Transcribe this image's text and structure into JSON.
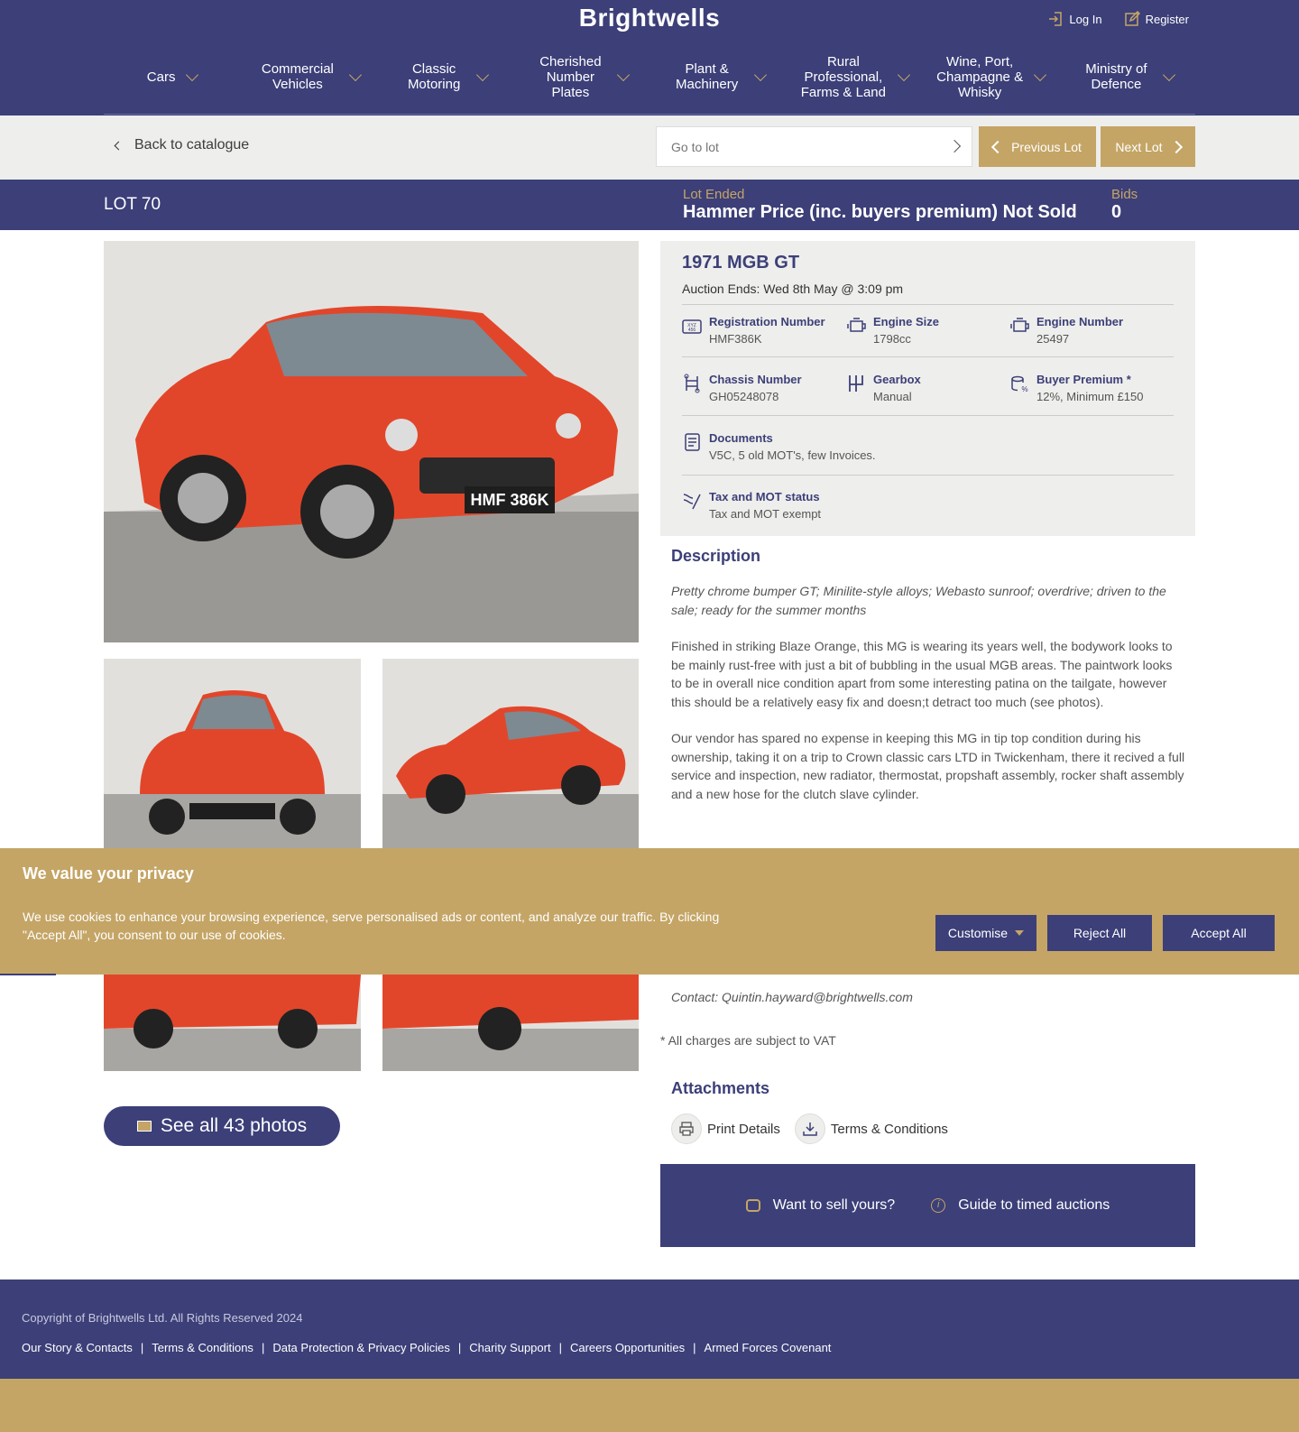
{
  "brand": {
    "name": "Brightwells"
  },
  "auth": {
    "login": "Log In",
    "register": "Register"
  },
  "nav": [
    {
      "label": "Cars"
    },
    {
      "label": "Commercial Vehicles"
    },
    {
      "label": "Classic Motoring"
    },
    {
      "label": "Cherished Number Plates"
    },
    {
      "label": "Plant & Machinery"
    },
    {
      "label": "Rural Professional, Farms & Land"
    },
    {
      "label": "Wine, Port, Champagne & Whisky"
    },
    {
      "label": "Ministry of Defence"
    }
  ],
  "toolbar": {
    "back": "Back to catalogue",
    "goto_placeholder": "Go to lot",
    "prev": "Previous Lot",
    "next": "Next Lot"
  },
  "lot": {
    "number": "LOT 70",
    "status_label": "Lot Ended",
    "status_value": "Hammer Price (inc. buyers premium) Not Sold",
    "bids_label": "Bids",
    "bids_value": "0"
  },
  "vehicle": {
    "title": "1971 MGB GT",
    "auction_ends": "Auction Ends: Wed 8th May @ 3:09 pm",
    "specs": {
      "registration": {
        "label": "Registration Number",
        "value": "HMF386K"
      },
      "engine_size": {
        "label": "Engine Size",
        "value": "1798cc"
      },
      "engine_number": {
        "label": "Engine Number",
        "value": "25497"
      },
      "chassis": {
        "label": "Chassis Number",
        "value": "GH05248078"
      },
      "gearbox": {
        "label": "Gearbox",
        "value": "Manual"
      },
      "buyer_premium": {
        "label": "Buyer Premium *",
        "value": "12%, Minimum £150"
      },
      "documents": {
        "label": "Documents",
        "value": "V5C, 5 old MOT's, few Invoices."
      },
      "tax": {
        "label": "Tax and MOT status",
        "value": "Tax and MOT exempt"
      }
    }
  },
  "gallery": {
    "see_all": "See all 43 photos",
    "plate": "HMF 386K"
  },
  "description": {
    "heading": "Description",
    "lead": "Pretty chrome bumper GT; Minilite-style alloys; Webasto sunroof; overdrive; driven to the sale; ready for the summer months",
    "p1": "Finished in striking Blaze Orange, this MG is wearing its years well, the bodywork looks to be mainly rust-free with just a bit of bubbling in the usual MGB areas. The paintwork looks to be in overall nice condition apart from some interesting patina on the tailgate, however this should be a relatively easy fix and doesn;t detract too much (see photos).",
    "p2": "Our vendor has spared no expense in keeping this MG in tip top condition during his ownership, taking it on a trip to Crown classic cars LTD in Twickenham, there it recived a full service and inspection, new radiator, thermostat, propshaft assembly, rocker shaft assembly and a new hose for the clutch slave cylinder.",
    "contact": "Contact: Quintin.hayward@brightwells.com",
    "vat": "* All charges are subject to VAT"
  },
  "attachments": {
    "heading": "Attachments",
    "print": "Print Details",
    "terms": "Terms & Conditions"
  },
  "cta": {
    "sell": "Want to sell yours?",
    "guide": "Guide to timed auctions"
  },
  "footer": {
    "copyright": "Copyright of Brightwells Ltd. All Rights Reserved 2024",
    "links": [
      "Our Story & Contacts",
      "Terms & Conditions",
      "Data Protection & Privacy Policies",
      "Charity Support",
      "Careers Opportunities",
      "Armed Forces Covenant"
    ]
  },
  "cookie": {
    "title": "We value your privacy",
    "text": "We use cookies to enhance your browsing experience, serve personalised ads or content, and analyze our traffic. By clicking \"Accept All\", you consent to our use of cookies.",
    "customise": "Customise",
    "reject": "Reject All",
    "accept": "Accept All"
  },
  "colors": {
    "navy": "#3c3f78",
    "gold": "#c4a566",
    "car": "#e2462a"
  }
}
